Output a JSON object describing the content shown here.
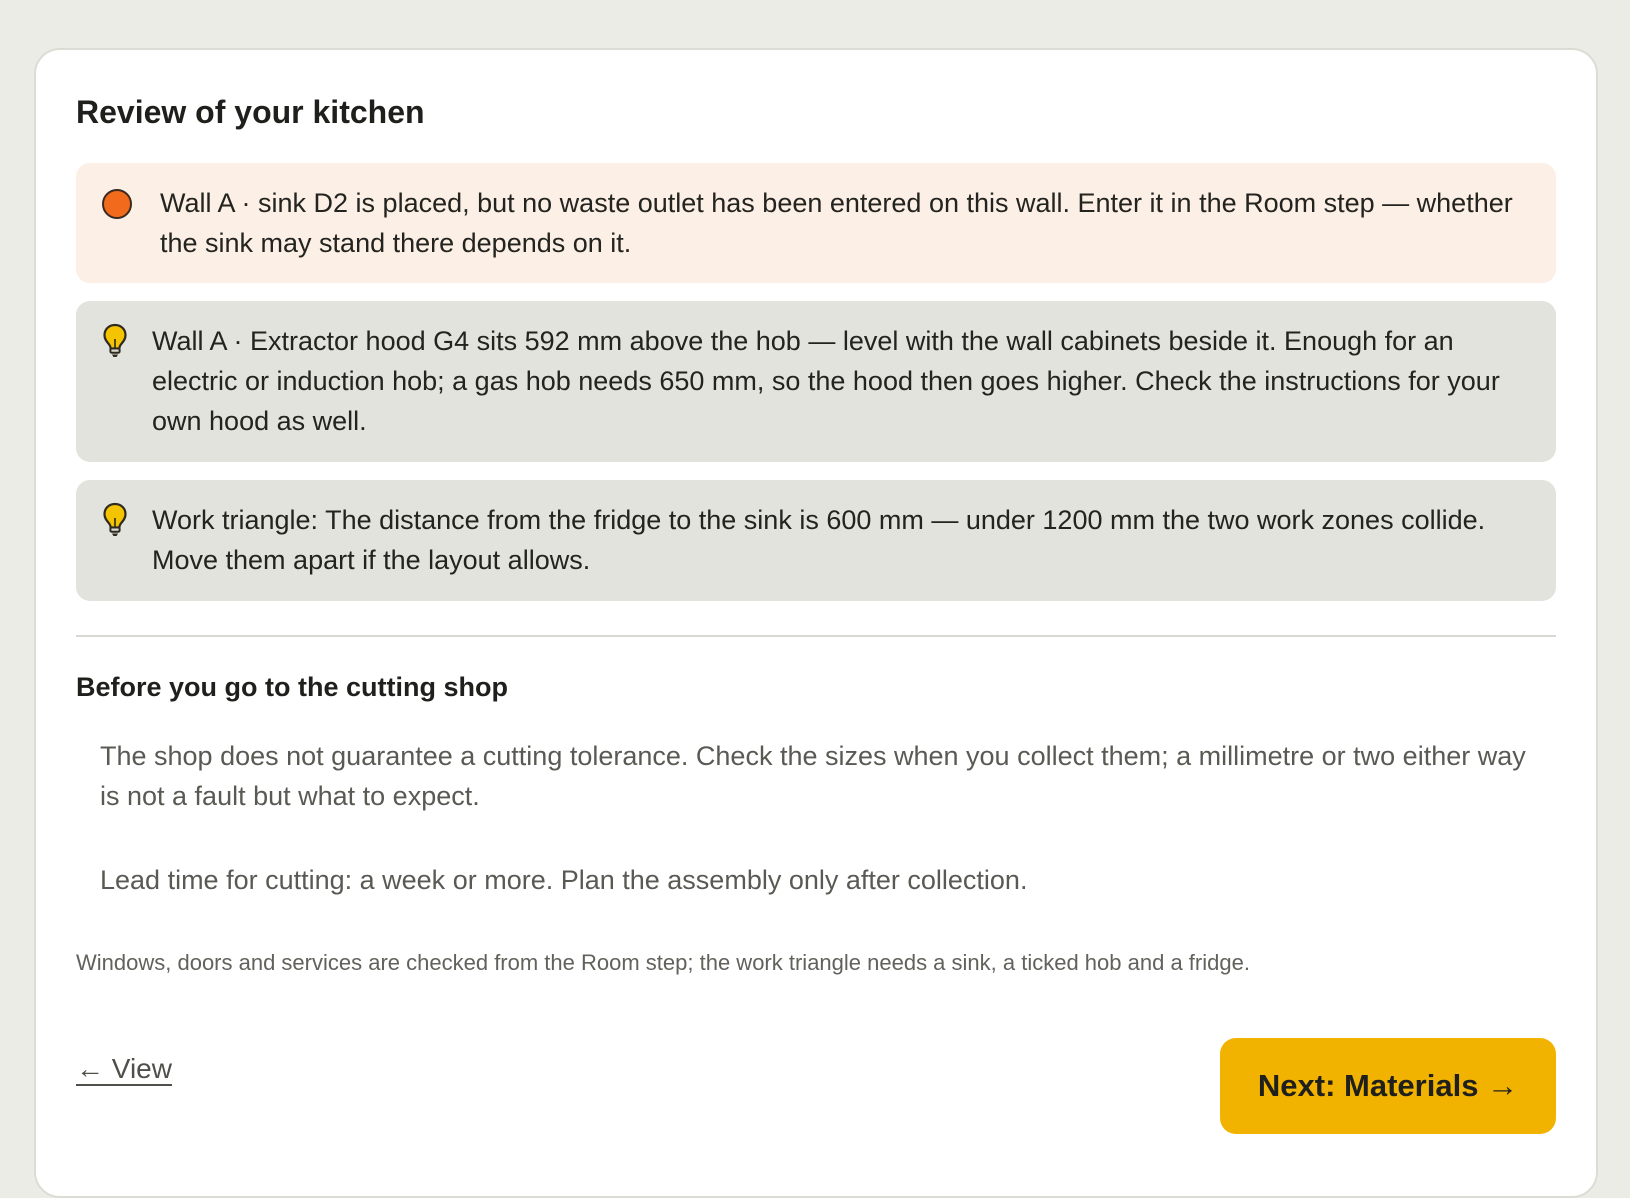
{
  "review": {
    "title": "Review of your kitchen",
    "notices": [
      {
        "kind": "warning",
        "icon": "orange-dot-icon",
        "text": "Wall A · sink D2 is placed, but no waste outlet has been entered on this wall. Enter it in the Room step — whether the sink may stand there depends on it."
      },
      {
        "kind": "tip",
        "icon": "lightbulb-icon",
        "text": "Wall A · Extractor hood G4 sits 592 mm above the hob — level with the wall cabinets beside it. Enough for an electric or induction hob; a gas hob needs 650 mm, so the hood then goes higher. Check the instructions for your own hood as well."
      },
      {
        "kind": "tip",
        "icon": "lightbulb-icon",
        "text": "Work triangle: The distance from the fridge to the sink is 600 mm — under 1200 mm the two work zones collide. Move them apart if the layout allows."
      }
    ]
  },
  "cutting_shop": {
    "title": "Before you go to the cutting shop",
    "paragraphs": [
      "The shop does not guarantee a cutting tolerance. Check the sizes when you collect them; a millimetre or two either way is not a fault but what to expect.",
      "Lead time for cutting: a week or more. Plan the assembly only after collection."
    ]
  },
  "footnote": "Windows, doors and services are checked from the Room step; the work triangle needs a sink, a ticked hob and a fridge.",
  "nav": {
    "back_label": "← View",
    "next_label": "Next: Materials →"
  },
  "colors": {
    "page_background": "#ecece6",
    "card_background": "#ffffff",
    "warning_background": "#fbefe6",
    "warning_dot": "#f26a1b",
    "tip_background": "#e2e3dc",
    "bulb_fill": "#f5c400",
    "primary_button": "#f1b300"
  }
}
